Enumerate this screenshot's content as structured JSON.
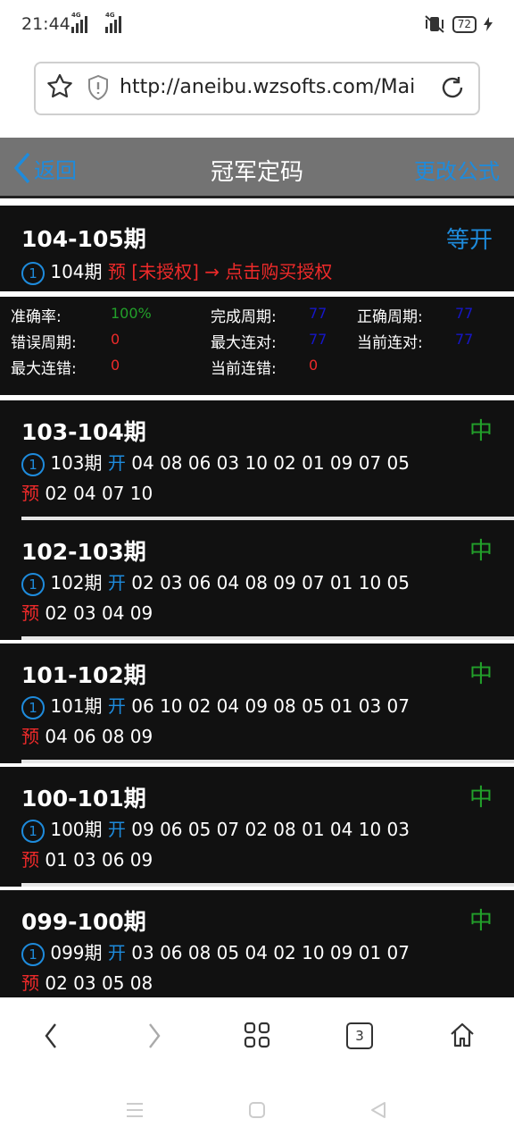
{
  "status_bar": {
    "time": "21:44",
    "signal1_label": "4G",
    "signal2_label": "4G",
    "battery": "72"
  },
  "browser": {
    "url": "http://aneibu.wzsofts.com/Mai..."
  },
  "header": {
    "back_label": "返回",
    "title": "冠军定码",
    "formula_label": "更改公式"
  },
  "current": {
    "period": "104-105期",
    "status": "等开",
    "index": "1",
    "issue": "104期",
    "pred_label": "预",
    "auth_text": "[未授权] → 点击购买授权"
  },
  "stats": {
    "accuracy_label": "准确率:",
    "accuracy_value": "100%",
    "done_label": "完成周期:",
    "done_value": "77",
    "correct_label": "正确周期:",
    "correct_value": "77",
    "wrong_label": "错误周期:",
    "wrong_value": "0",
    "maxwin_label": "最大连对:",
    "maxwin_value": "77",
    "curwin_label": "当前连对:",
    "curwin_value": "77",
    "maxlose_label": "最大连错:",
    "maxlose_value": "0",
    "curlose_label": "当前连错:",
    "curlose_value": "0"
  },
  "history": [
    {
      "period": "103-104期",
      "result": "中",
      "index": "1",
      "issue": "103期",
      "open_label": "开",
      "open": "04 08 06 03 10 02 01 09 07 05",
      "pred_label": "预",
      "pred": "02 04 07 10"
    },
    {
      "period": "102-103期",
      "result": "中",
      "index": "1",
      "issue": "102期",
      "open_label": "开",
      "open": "02 03 06 04 08 09 07 01 10 05",
      "pred_label": "预",
      "pred": "02 03 04 09"
    },
    {
      "period": "101-102期",
      "result": "中",
      "index": "1",
      "issue": "101期",
      "open_label": "开",
      "open": "06 10 02 04 09 08 05 01 03 07",
      "pred_label": "预",
      "pred": "04 06 08 09"
    },
    {
      "period": "100-101期",
      "result": "中",
      "index": "1",
      "issue": "100期",
      "open_label": "开",
      "open": "09 06 05 07 02 08 01 04 10 03",
      "pred_label": "预",
      "pred": "01 03 06 09"
    },
    {
      "period": "099-100期",
      "result": "中",
      "index": "1",
      "issue": "099期",
      "open_label": "开",
      "open": "03 06 08 05 04 02 10 09 01 07",
      "pred_label": "预",
      "pred": "02 03 05 08"
    }
  ],
  "bottom_nav": {
    "tab_count": "3"
  },
  "colors": {
    "accent_blue": "#1e8bdc",
    "pred_red": "#ee2a2a",
    "hit_green": "#22a02a",
    "header_gray": "#737373",
    "panel_black": "#111111"
  }
}
